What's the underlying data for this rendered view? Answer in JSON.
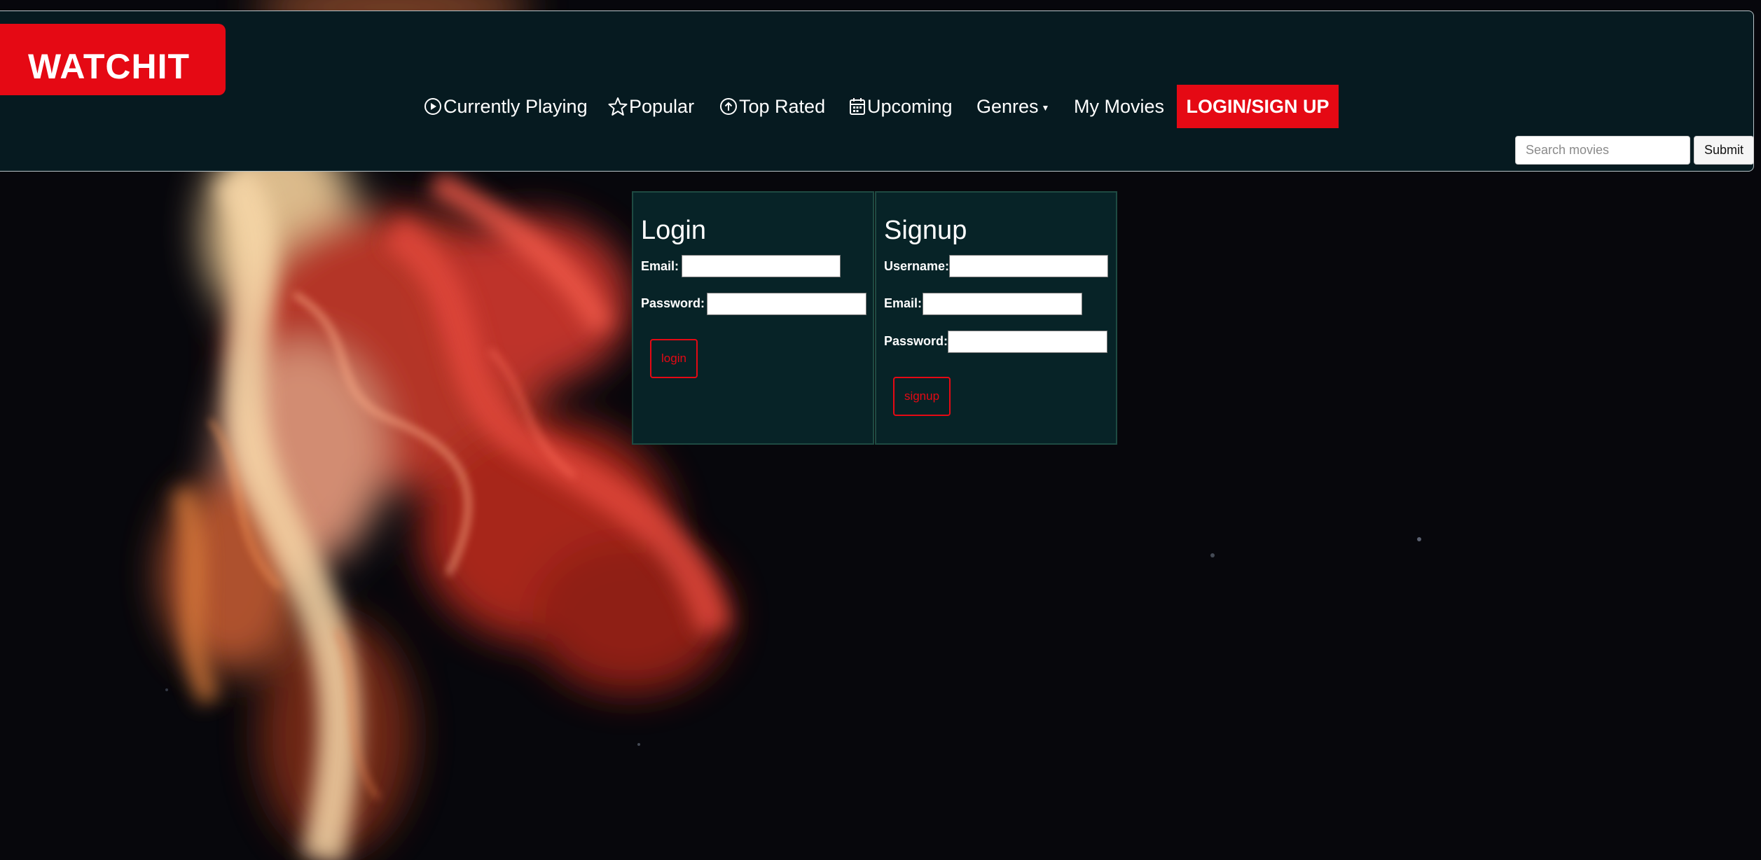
{
  "brand": {
    "logo_text": "WATCHIT",
    "accent_color": "#e50914",
    "header_bg": "#061a20"
  },
  "nav": {
    "items": [
      {
        "label": "Currently Playing",
        "icon": "play-circle-icon"
      },
      {
        "label": "Popular",
        "icon": "star-icon"
      },
      {
        "label": "Top Rated",
        "icon": "arrow-up-circle-icon"
      },
      {
        "label": "Upcoming",
        "icon": "calendar-icon"
      },
      {
        "label": "Genres",
        "icon": "caret-down-icon"
      },
      {
        "label": "My Movies"
      }
    ],
    "login_signup": "LOGIN/SIGN UP"
  },
  "search": {
    "placeholder": "Search movies",
    "value": "",
    "submit_label": "Submit"
  },
  "login": {
    "title": "Login",
    "email_label": "Email:",
    "password_label": "Password:",
    "button_label": "login"
  },
  "signup": {
    "title": "Signup",
    "username_label": "Username:",
    "email_label": "Email:",
    "password_label": "Password:",
    "button_label": "signup"
  }
}
